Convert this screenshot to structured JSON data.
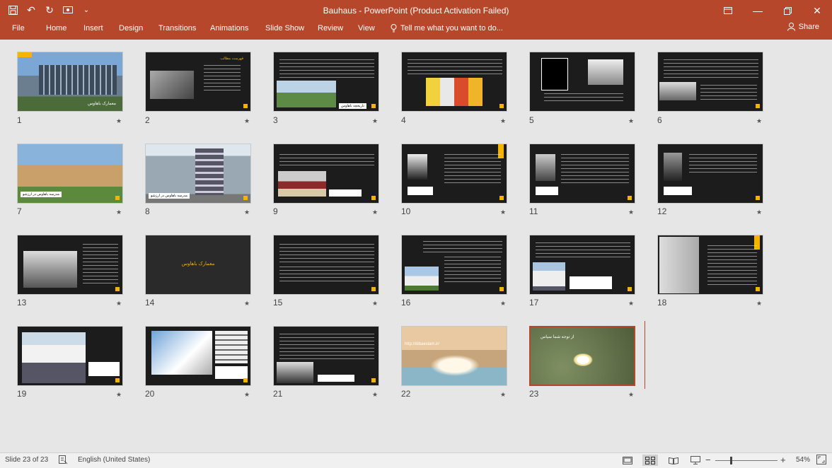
{
  "window": {
    "title": "Bauhaus - PowerPoint (Product Activation Failed)",
    "icons": [
      "save-icon",
      "undo-icon",
      "redo-icon",
      "present-icon",
      "customize-qat-icon"
    ],
    "controls": [
      "ribbon-display-icon",
      "restore-icon",
      "close-icon"
    ]
  },
  "ribbon": {
    "tabs": [
      "File",
      "Home",
      "Insert",
      "Design",
      "Transitions",
      "Animations",
      "Slide Show",
      "Review",
      "View"
    ],
    "tell_me": "Tell me what you want to do...",
    "share": "Share"
  },
  "slides": [
    {
      "num": "1",
      "thumb": "photo-building-title",
      "caption": "معمارک باهاوس",
      "tag": "Bauhaus"
    },
    {
      "num": "2",
      "thumb": "dark-list-image",
      "title": "فهرست مطالب"
    },
    {
      "num": "3",
      "thumb": "dark-text-image",
      "caption": "تاریخچه باهاوس"
    },
    {
      "num": "4",
      "thumb": "dark-text-art"
    },
    {
      "num": "5",
      "thumb": "dark-two-images"
    },
    {
      "num": "6",
      "thumb": "dark-text-image"
    },
    {
      "num": "7",
      "thumb": "photo-building",
      "caption": "مدرسه باهاوس در ارزشو"
    },
    {
      "num": "8",
      "thumb": "photo-building",
      "caption": "مدرسه باهاوس در ارزشو"
    },
    {
      "num": "9",
      "thumb": "dark-text-image"
    },
    {
      "num": "10",
      "thumb": "dark-portrait"
    },
    {
      "num": "11",
      "thumb": "dark-portrait"
    },
    {
      "num": "12",
      "thumb": "dark-portrait"
    },
    {
      "num": "13",
      "thumb": "dark-group-photo"
    },
    {
      "num": "14",
      "thumb": "dark-section",
      "title": "معمارک باهاوس"
    },
    {
      "num": "15",
      "thumb": "dark-text-only"
    },
    {
      "num": "16",
      "thumb": "dark-list-image"
    },
    {
      "num": "17",
      "thumb": "dark-text-image"
    },
    {
      "num": "18",
      "thumb": "dark-list-image"
    },
    {
      "num": "19",
      "thumb": "dark-house-photo"
    },
    {
      "num": "20",
      "thumb": "dark-balcony-photo"
    },
    {
      "num": "21",
      "thumb": "dark-text-image"
    },
    {
      "num": "22",
      "thumb": "photo-book",
      "text": "http://dibaeslam.ir/"
    },
    {
      "num": "23",
      "thumb": "photo-lily",
      "text": "از توجه شما سپاس"
    }
  ],
  "status": {
    "slide_info": "Slide 23 of 23",
    "language": "English (United States)",
    "zoom": "54%",
    "minus": "−",
    "plus": "+"
  },
  "colors": {
    "accent": "#b7472a",
    "highlight": "#f4b400"
  }
}
